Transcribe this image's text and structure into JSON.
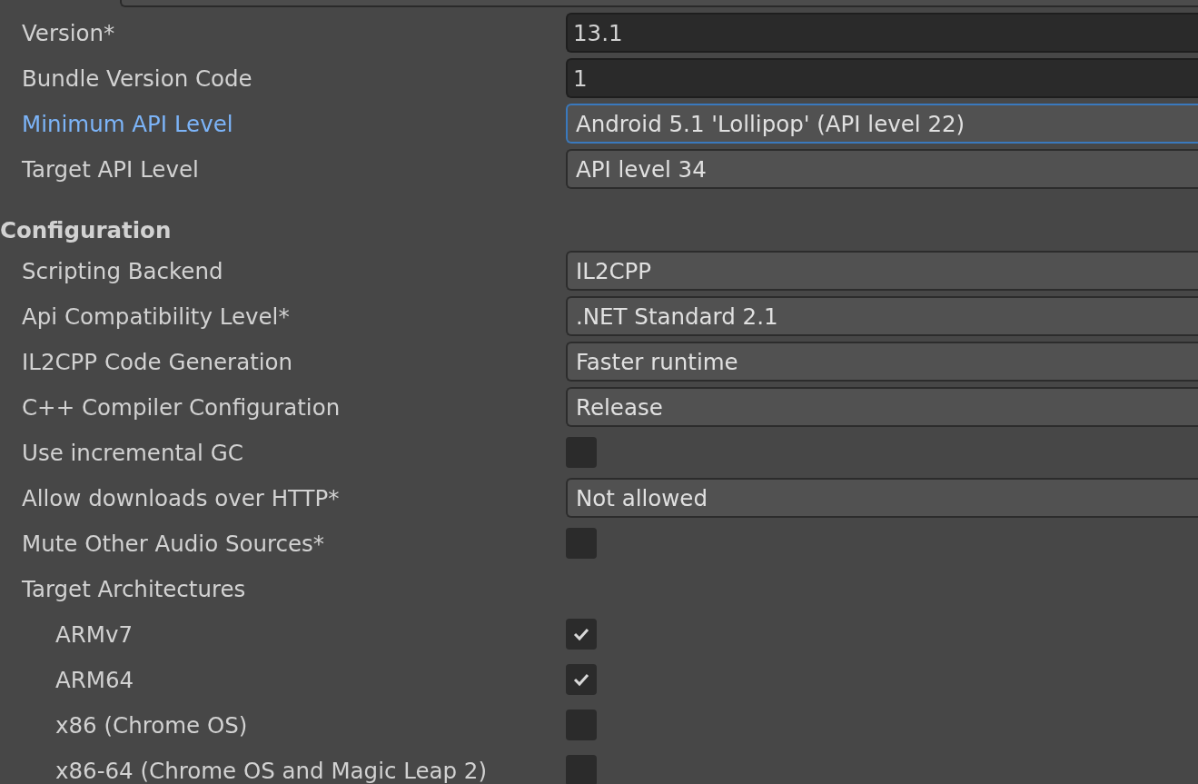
{
  "identification": {
    "fields": [
      {
        "label": "Version*",
        "kind": "text",
        "value": "13.1",
        "focused": false
      },
      {
        "label": "Bundle Version Code",
        "kind": "text",
        "value": "1",
        "focused": false
      },
      {
        "label": "Minimum API Level",
        "kind": "dropdown",
        "value": "Android 5.1 'Lollipop' (API level 22)",
        "focused": true
      },
      {
        "label": "Target API Level",
        "kind": "dropdown",
        "value": "API level 34",
        "focused": false
      }
    ]
  },
  "configuration": {
    "title": "Configuration",
    "fields": [
      {
        "label": "Scripting Backend",
        "kind": "dropdown",
        "value": "IL2CPP",
        "focused": false
      },
      {
        "label": "Api Compatibility Level*",
        "kind": "dropdown",
        "value": ".NET Standard 2.1",
        "focused": false
      },
      {
        "label": "IL2CPP Code Generation",
        "kind": "dropdown",
        "value": "Faster runtime",
        "focused": false
      },
      {
        "label": "C++ Compiler Configuration",
        "kind": "dropdown",
        "value": "Release",
        "focused": false
      },
      {
        "label": "Use incremental GC",
        "kind": "checkbox",
        "checked": false,
        "focused": false
      },
      {
        "label": "Allow downloads over HTTP*",
        "kind": "dropdown",
        "value": "Not allowed",
        "focused": false
      },
      {
        "label": "Mute Other Audio Sources*",
        "kind": "checkbox",
        "checked": false,
        "focused": false
      },
      {
        "label": "Target Architectures",
        "kind": "group",
        "focused": false,
        "children": [
          {
            "label": "ARMv7",
            "kind": "checkbox",
            "checked": true,
            "focused": false
          },
          {
            "label": "ARM64",
            "kind": "checkbox",
            "checked": true,
            "focused": false
          },
          {
            "label": "x86 (Chrome OS)",
            "kind": "checkbox",
            "checked": false,
            "focused": false
          },
          {
            "label": "x86-64 (Chrome OS and Magic Leap 2)",
            "kind": "checkbox",
            "checked": false,
            "focused": false
          }
        ]
      }
    ]
  }
}
